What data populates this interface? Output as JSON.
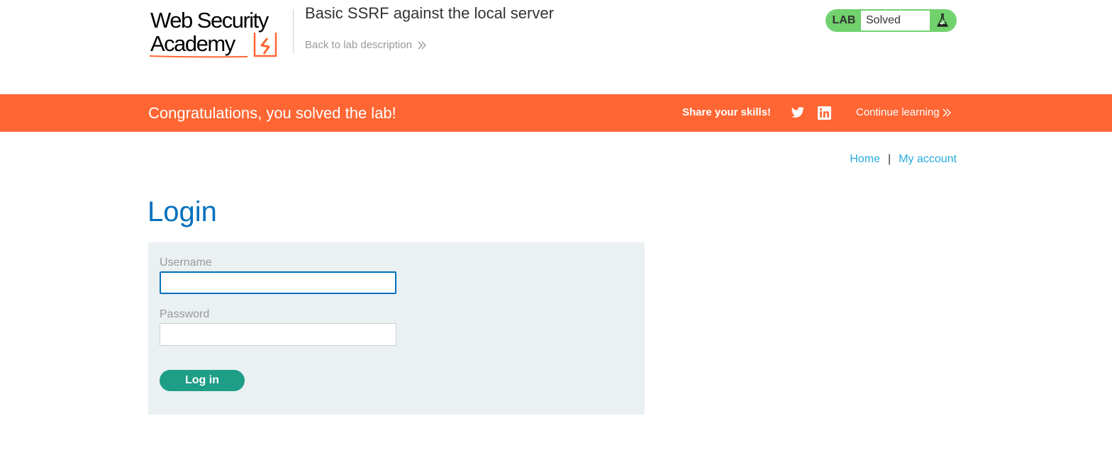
{
  "header": {
    "logo": {
      "line1": "Web Security",
      "line2": "Academy"
    },
    "lab_title": "Basic SSRF against the local server",
    "back_link": "Back to lab description",
    "status": {
      "badge": "LAB",
      "text": "Solved"
    }
  },
  "banner": {
    "message": "Congratulations, you solved the lab!",
    "share_label": "Share your skills!",
    "continue_label": "Continue learning"
  },
  "nav": {
    "home": "Home",
    "separator": "|",
    "account": "My account"
  },
  "page": {
    "title": "Login"
  },
  "form": {
    "username_label": "Username",
    "username_value": "",
    "password_label": "Password",
    "password_value": "",
    "submit_label": "Log in"
  },
  "colors": {
    "banner": "#ff6633",
    "title_blue": "#0071bc",
    "link_blue": "#29abe0",
    "status_green": "#70d16d",
    "button_green": "#1e9e87",
    "panel_bg": "#ebf0f2"
  },
  "icons": {
    "logo_mark": "lightning-bolt-bracket",
    "status_icon": "flask-check-icon",
    "share_1": "twitter-icon",
    "share_2": "linkedin-icon",
    "chevron": "double-chevron-right-icon"
  }
}
